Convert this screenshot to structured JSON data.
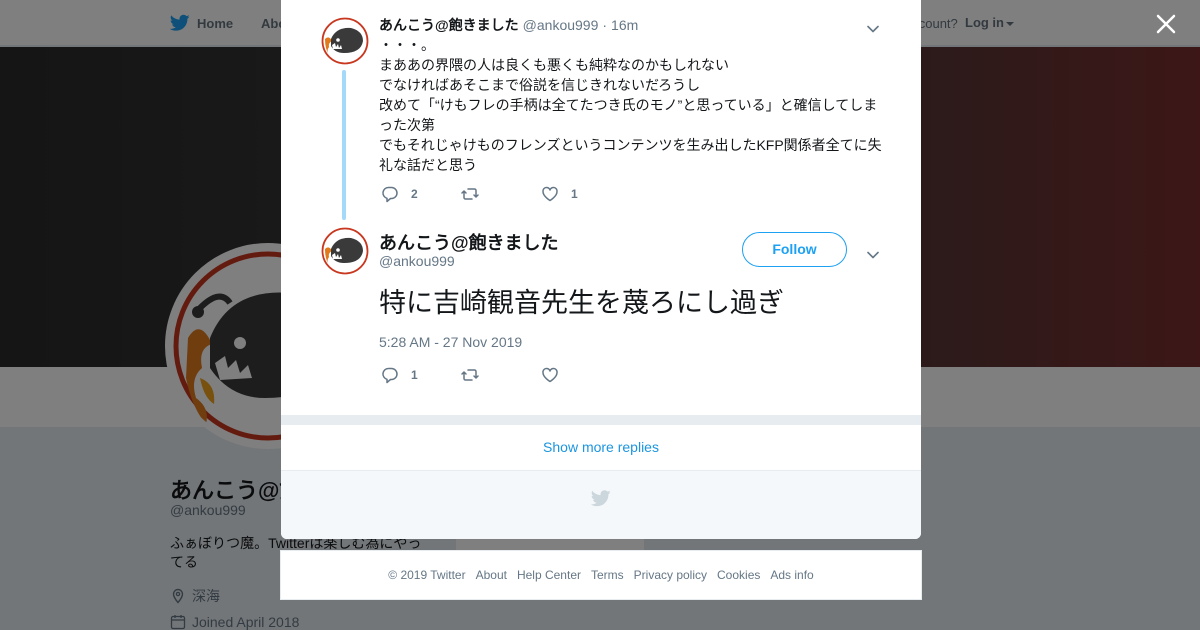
{
  "topbar": {
    "home_label": "Home",
    "about_label": "About",
    "have_account_text": "account?",
    "login_label": "Log in"
  },
  "profile": {
    "name": "あんこう@飽きました",
    "handle": "@ankou999",
    "bio": "ふぁぼりつ魔。Twitterは楽しむ為にやってる",
    "location": "深海",
    "joined": "Joined April 2018"
  },
  "modal": {
    "parent_tweet": {
      "name": "あんこう@飽きました",
      "handle": "@ankou999",
      "separator": "·",
      "time": "16m",
      "lines": [
        "・・・。",
        "まああの界隈の人は良くも悪くも純粋なのかもしれない",
        "でなければあそこまで俗説を信じきれないだろうし",
        "改めて「“けもフレの手柄は全てたつき氏のモノ”と思っている」と確信してしまった次第",
        "でもそれじゃけものフレンズというコンテンツを生み出したKFP関係者全てに失礼な話だと思う"
      ],
      "reply_count": "2",
      "retweet_count": "",
      "like_count": "1"
    },
    "main_tweet": {
      "name": "あんこう@飽きました",
      "handle": "@ankou999",
      "follow_label": "Follow",
      "text": "特に吉崎観音先生を蔑ろにし過ぎ",
      "timestamp": "5:28 AM - 27 Nov 2019",
      "reply_count": "1",
      "retweet_count": "",
      "like_count": ""
    },
    "show_more_label": "Show more replies"
  },
  "footer": {
    "copyright": "© 2019 Twitter",
    "links": [
      "About",
      "Help Center",
      "Terms",
      "Privacy policy",
      "Cookies",
      "Ads info"
    ]
  },
  "colors": {
    "accent": "#1da1f2",
    "link": "#1b95e0",
    "thread_line": "#a4d9f9",
    "muted_text": "#657786"
  }
}
